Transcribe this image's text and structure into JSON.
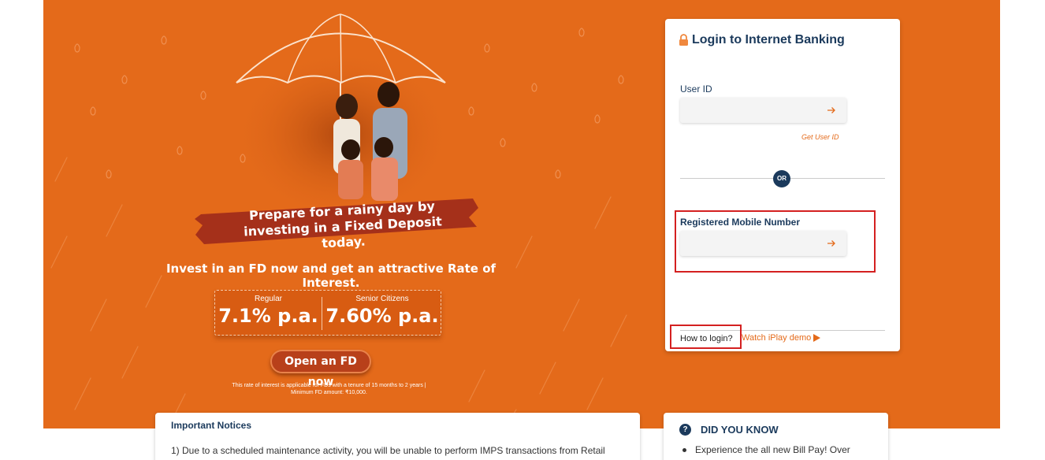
{
  "banner": {
    "headline": "Prepare for a rainy day by investing in a Fixed Deposit today.",
    "subheadline": "Invest in an FD now and get an attractive Rate of Interest.",
    "rates": {
      "regular_label": "Regular",
      "regular_value": "7.1% p.a.",
      "senior_label": "Senior Citizens",
      "senior_value": "7.60% p.a."
    },
    "cta_label": "Open an FD now",
    "fine_print_1": "This rate of interest is applicable for FDs with a tenure of 15 months to 2 years |",
    "fine_print_2": "Minimum FD amount: ₹10,000."
  },
  "login": {
    "title": "Login to Internet Banking",
    "user_id_label": "User ID",
    "user_id_value": "",
    "get_user_id": "Get User ID",
    "or_label": "OR",
    "mobile_label": "Registered Mobile Number",
    "mobile_value": "",
    "how_to_login": "How to login?",
    "watch_demo": "Watch iPlay demo"
  },
  "notices": {
    "title": "Important Notices",
    "item_1": "1) Due to a scheduled maintenance activity, you will be unable to perform IMPS transactions from Retail"
  },
  "did_you_know": {
    "title": "DID YOU KNOW",
    "item_1": "Experience the all new Bill Pay! Over"
  },
  "colors": {
    "brand_orange": "#e46a1a",
    "navy": "#1b3a5c",
    "highlight_red": "#d42020"
  }
}
